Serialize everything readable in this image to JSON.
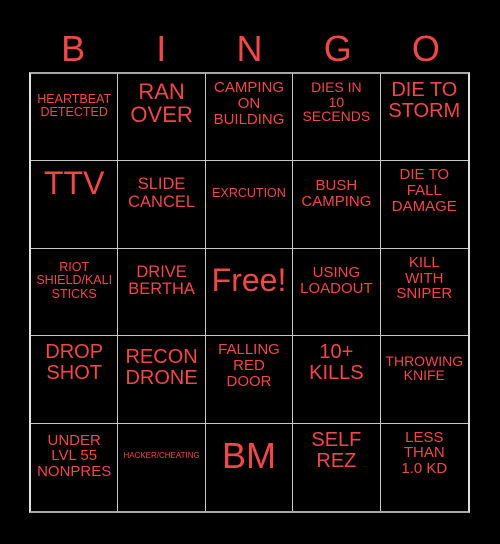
{
  "header": {
    "letters": [
      "B",
      "I",
      "N",
      "G",
      "O"
    ]
  },
  "colors": {
    "background": "#000000",
    "text": "#f04848",
    "grid_lines": "#c8c8c8"
  },
  "cells": [
    {
      "text": "HEARTBEAT\nDETECTED"
    },
    {
      "text": "RAN\nOVER"
    },
    {
      "text": "CAMPING\nON\nBUILDING"
    },
    {
      "text": "DIES IN\n10\nSECENDS"
    },
    {
      "text": "DIE TO\nSTORM"
    },
    {
      "text": "TTV"
    },
    {
      "text": "SLIDE\nCANCEL"
    },
    {
      "text": "EXRCUTION"
    },
    {
      "text": "BUSH\nCAMPING"
    },
    {
      "text": "DIE TO\nFALL\nDAMAGE"
    },
    {
      "text": "RIOT\nSHIELD/KALI\nSTICKS"
    },
    {
      "text": "DRIVE\nBERTHA"
    },
    {
      "text": "Free!"
    },
    {
      "text": "USING\nLOADOUT"
    },
    {
      "text": "KILL\nWITH\nSNIPER"
    },
    {
      "text": "DROP\nSHOT"
    },
    {
      "text": "RECON\nDRONE"
    },
    {
      "text": "FALLING\nRED\nDOOR"
    },
    {
      "text": "10+\nKILLS"
    },
    {
      "text": "THROWING\nKNIFE"
    },
    {
      "text": "UNDER\nLVL 55\nNONPRES"
    },
    {
      "text": "HACKER/CHEATING"
    },
    {
      "text": "BM"
    },
    {
      "text": "SELF\nREZ"
    },
    {
      "text": "LESS\nTHAN\n1.0 KD"
    }
  ]
}
